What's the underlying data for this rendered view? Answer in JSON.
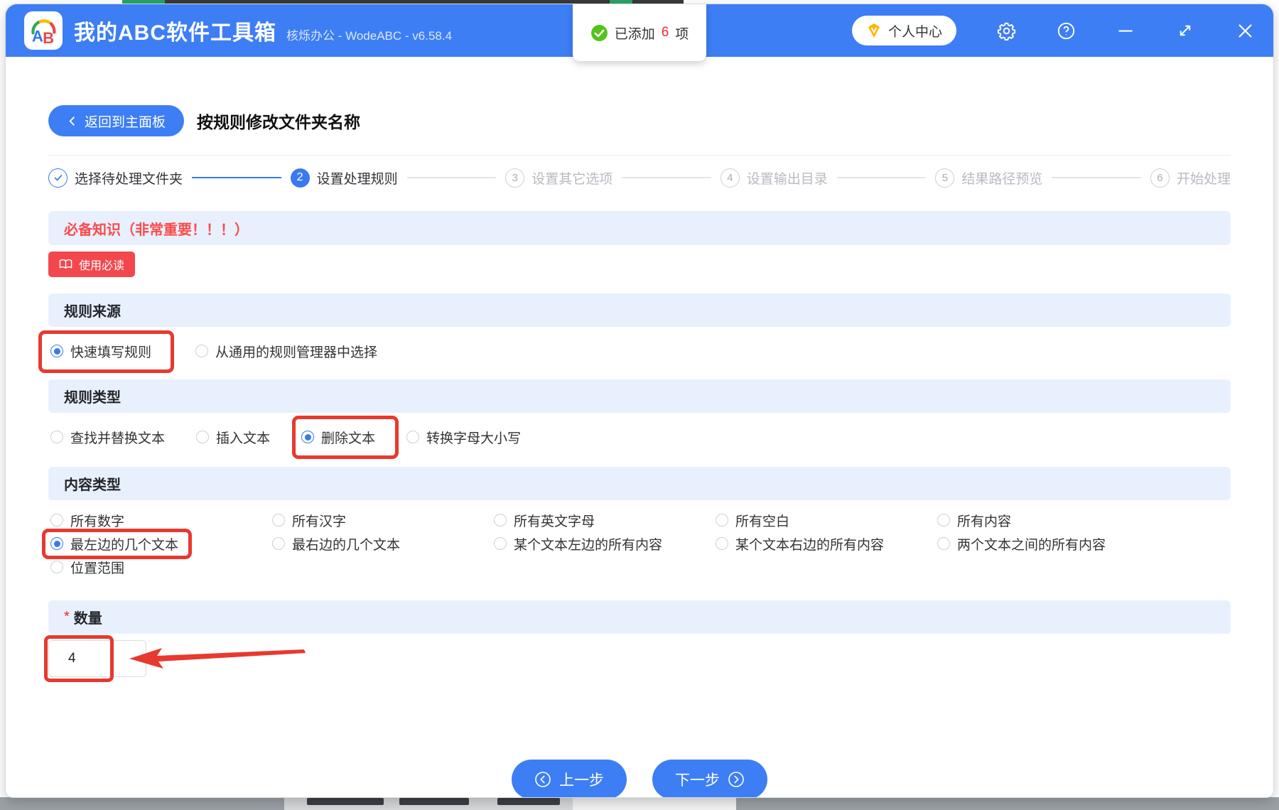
{
  "titlebar": {
    "logo": "AB",
    "title": "我的ABC软件工具箱",
    "subtitle": "核烁办公 - WodeABC - v6.58.4",
    "toast": {
      "prefix": "已添加",
      "count": "6",
      "suffix": "项"
    },
    "user_center": "个人中心"
  },
  "nav": {
    "back": "返回到主面板",
    "page_title": "按规则修改文件夹名称"
  },
  "steps": [
    {
      "num": "1",
      "label": "选择待处理文件夹",
      "state": "done"
    },
    {
      "num": "2",
      "label": "设置处理规则",
      "state": "active"
    },
    {
      "num": "3",
      "label": "设置其它选项",
      "state": "todo"
    },
    {
      "num": "4",
      "label": "设置输出目录",
      "state": "todo"
    },
    {
      "num": "5",
      "label": "结果路径预览",
      "state": "todo"
    },
    {
      "num": "6",
      "label": "开始处理",
      "state": "todo"
    }
  ],
  "notice": {
    "banner": "必备知识（非常重要！！！）",
    "read_button": "使用必读"
  },
  "rule_source": {
    "title": "规则来源",
    "options": [
      {
        "label": "快速填写规则",
        "selected": true,
        "annotated": true
      },
      {
        "label": "从通用的规则管理器中选择",
        "selected": false
      }
    ]
  },
  "rule_type": {
    "title": "规则类型",
    "options": [
      {
        "label": "查找并替换文本",
        "selected": false
      },
      {
        "label": "插入文本",
        "selected": false
      },
      {
        "label": "删除文本",
        "selected": true,
        "annotated": true
      },
      {
        "label": "转换字母大小写",
        "selected": false
      }
    ]
  },
  "content_type": {
    "title": "内容类型",
    "rows": [
      [
        {
          "label": "所有数字",
          "selected": false
        },
        {
          "label": "所有汉字",
          "selected": false
        },
        {
          "label": "所有英文字母",
          "selected": false
        },
        {
          "label": "所有空白",
          "selected": false
        },
        {
          "label": "所有内容",
          "selected": false
        }
      ],
      [
        {
          "label": "最左边的几个文本",
          "selected": true,
          "annotated": true
        },
        {
          "label": "最右边的几个文本",
          "selected": false
        },
        {
          "label": "某个文本左边的所有内容",
          "selected": false
        },
        {
          "label": "某个文本右边的所有内容",
          "selected": false
        },
        {
          "label": "两个文本之间的所有内容",
          "selected": false
        }
      ],
      [
        {
          "label": "位置范围",
          "selected": false
        }
      ]
    ]
  },
  "quantity": {
    "required_mark": "*",
    "title": "数量",
    "value": "4"
  },
  "footer": {
    "prev": "上一步",
    "next": "下一步"
  },
  "colors": {
    "accent": "#3d7ef5",
    "annotation": "#e8392e",
    "danger_button": "#f2484d",
    "banner_text": "#fb4b4b",
    "band_bg": "#e9f0fd",
    "success": "#52c41a",
    "count_red": "#f5222d"
  }
}
